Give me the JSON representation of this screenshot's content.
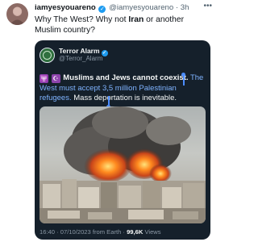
{
  "tweet": {
    "author_name": "iamyesyouareno",
    "author_handle": "@iamyesyouareno",
    "separator": "·",
    "time_ago": "3h",
    "more_icon": "ellipsis-icon",
    "text_before": "Why The West? Why not ",
    "text_bold": "Iran",
    "text_after": " or another Muslim country?"
  },
  "quoted": {
    "name": "Terror Alarm",
    "handle": "@Terror_Alarm",
    "badge_1": "🕎",
    "badge_2": "☪",
    "text_bold": "Muslims and Jews cannot coexist.",
    "text_sel_1": " The West must accept 3,5 million Palestinian refugees.",
    "text_rest": " Mass deportation is inevitable.",
    "footer_time": "16:40 · 07/10/2023 from Earth · ",
    "footer_views": "99,6K",
    "footer_views_label": " Views",
    "colors": {
      "card_bg": "#15202b",
      "verified": "#1d9bf0",
      "selection": "#4c8dff"
    }
  }
}
